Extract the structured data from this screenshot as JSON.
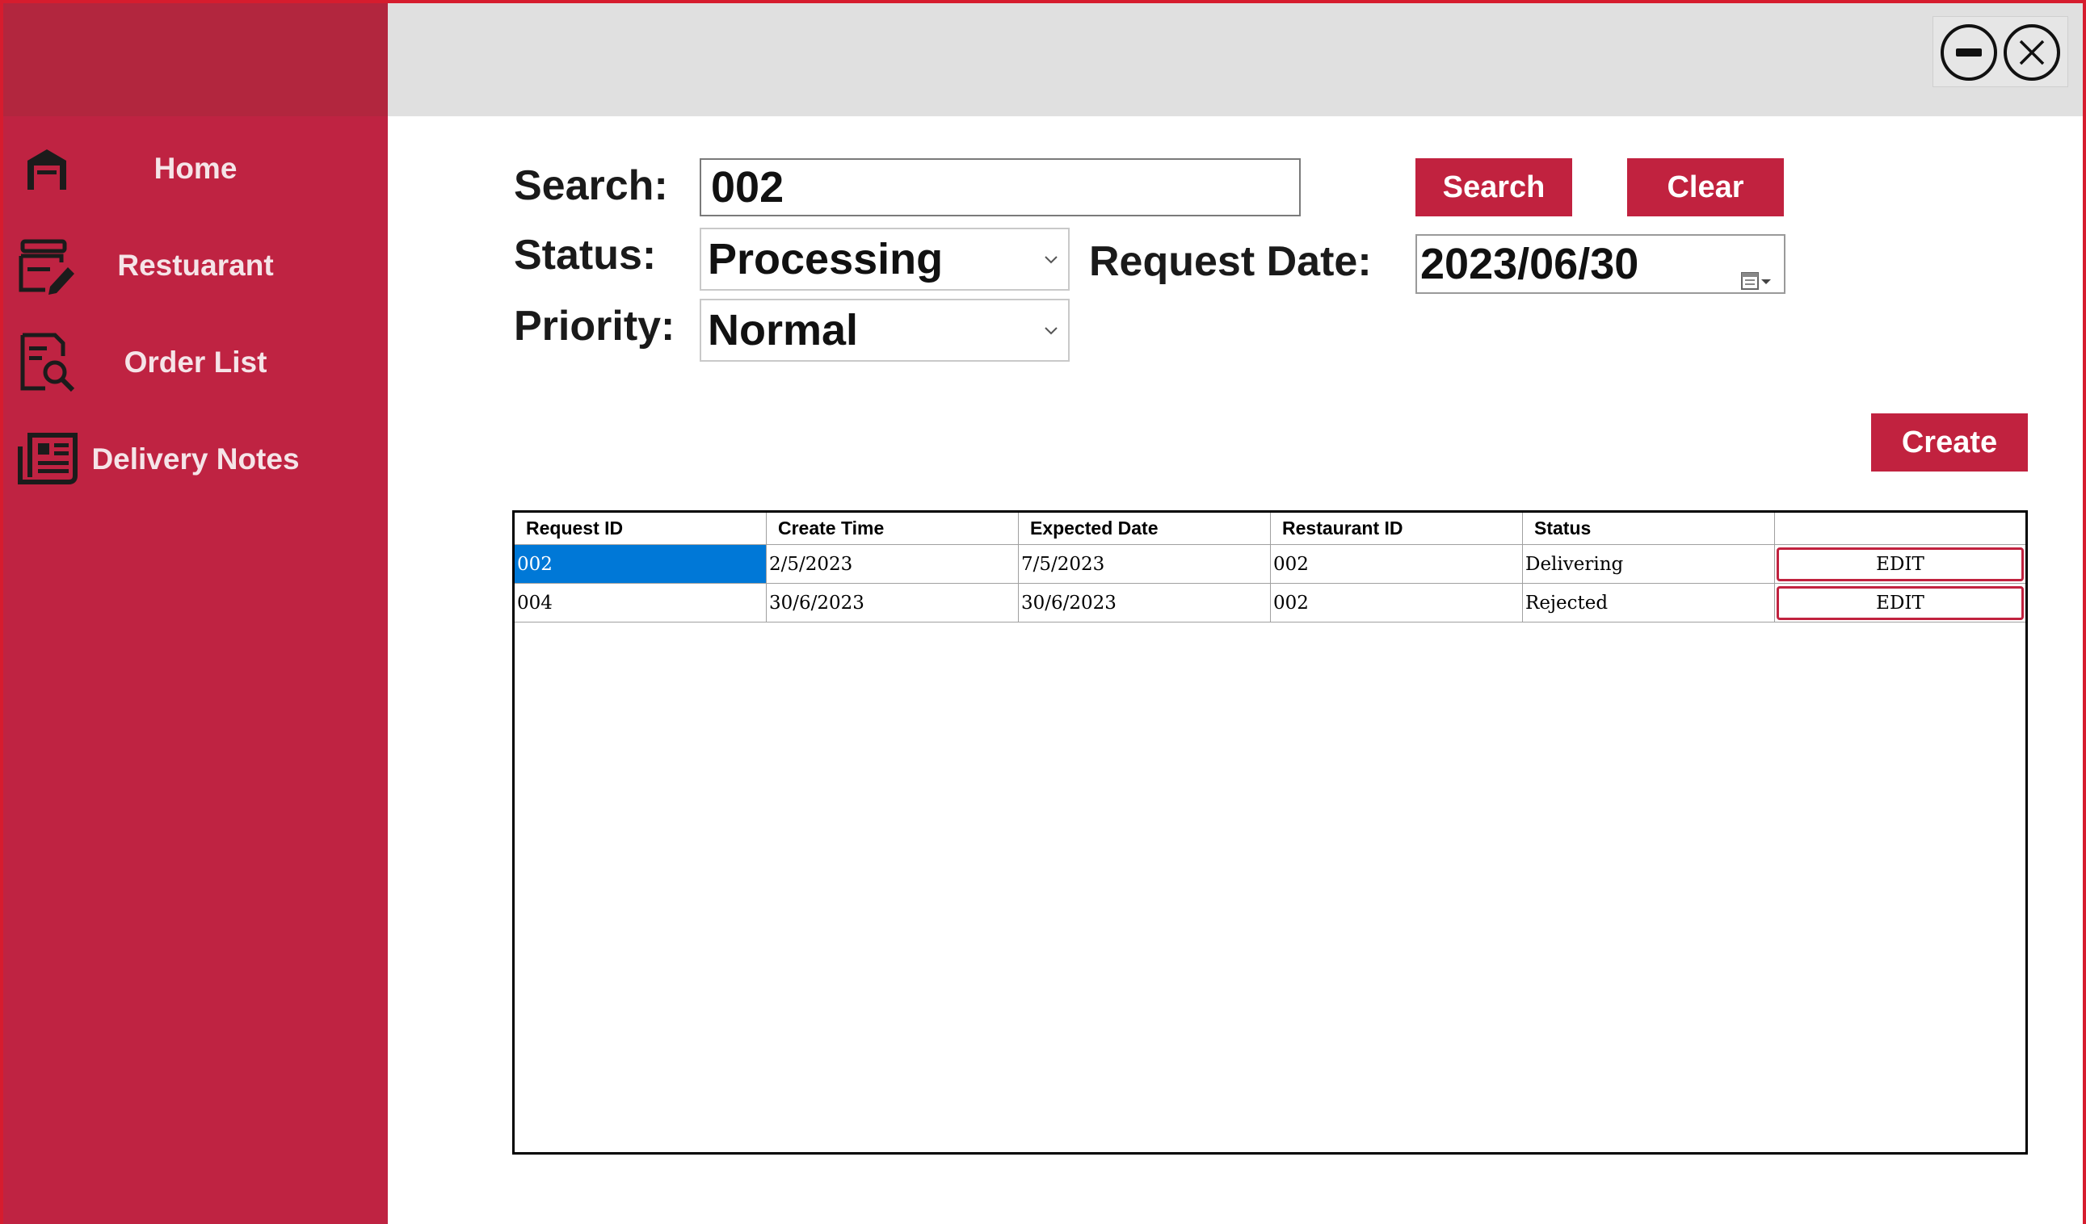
{
  "sidebar": {
    "items": [
      {
        "label": "Home",
        "icon": "warehouse-icon"
      },
      {
        "label": "Restuarant",
        "icon": "menu-edit-icon"
      },
      {
        "label": "Order List",
        "icon": "document-search-icon"
      },
      {
        "label": "Delivery Notes",
        "icon": "newspaper-icon"
      }
    ]
  },
  "titlebar": {
    "minimize_icon": "minimize-icon",
    "close_icon": "close-icon"
  },
  "filters": {
    "search_label": "Search:",
    "search_value": "002",
    "status_label": "Status:",
    "status_value": "Processing",
    "priority_label": "Priority:",
    "priority_value": "Normal",
    "request_date_label": "Request Date:",
    "request_date_value": "2023/06/30"
  },
  "buttons": {
    "search": "Search",
    "clear": "Clear",
    "create": "Create"
  },
  "grid": {
    "columns": [
      "Request ID",
      "Create Time",
      "Expected Date",
      "Restaurant ID",
      "Status",
      ""
    ],
    "rows": [
      {
        "request_id": "002",
        "create_time": "2/5/2023",
        "expected_date": "7/5/2023",
        "restaurant_id": "002",
        "status": "Delivering",
        "action": "EDIT"
      },
      {
        "request_id": "004",
        "create_time": "30/6/2023",
        "expected_date": "30/6/2023",
        "restaurant_id": "002",
        "status": "Rejected",
        "action": "EDIT"
      }
    ],
    "selected_cell": "rows.0.request_id"
  },
  "colors": {
    "accent": "#bf2342",
    "sidebar_header": "#b2263e",
    "selection": "#0078d7",
    "window_border": "#d61c2e"
  }
}
